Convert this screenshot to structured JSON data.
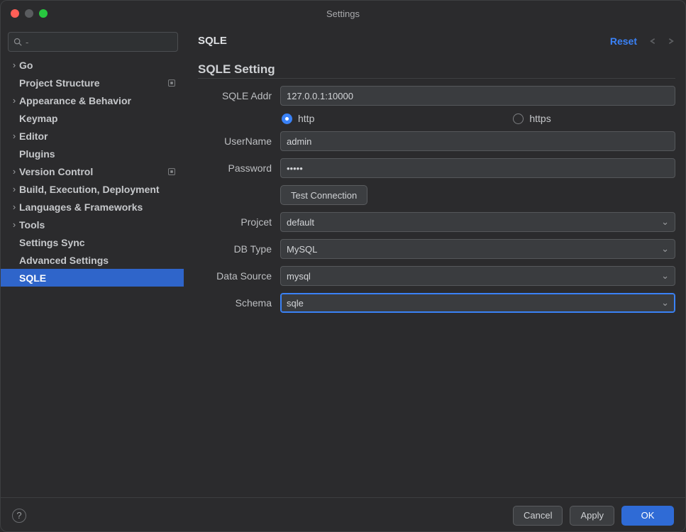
{
  "window": {
    "title": "Settings"
  },
  "search": {
    "placeholder": ""
  },
  "sidebar": {
    "items": [
      {
        "label": "Go",
        "expandable": true
      },
      {
        "label": "Project Structure",
        "expandable": false,
        "modified": true
      },
      {
        "label": "Appearance & Behavior",
        "expandable": true
      },
      {
        "label": "Keymap",
        "expandable": false
      },
      {
        "label": "Editor",
        "expandable": true
      },
      {
        "label": "Plugins",
        "expandable": false
      },
      {
        "label": "Version Control",
        "expandable": true,
        "modified": true
      },
      {
        "label": "Build, Execution, Deployment",
        "expandable": true
      },
      {
        "label": "Languages & Frameworks",
        "expandable": true
      },
      {
        "label": "Tools",
        "expandable": true
      },
      {
        "label": "Settings Sync",
        "expandable": false
      },
      {
        "label": "Advanced Settings",
        "expandable": false
      },
      {
        "label": "SQLE",
        "expandable": false,
        "selected": true
      }
    ]
  },
  "breadcrumb": "SQLE",
  "reset_label": "Reset",
  "section": "SQLE Setting",
  "form": {
    "addr_label": "SQLE Addr",
    "addr_value": "127.0.0.1:10000",
    "protocol_http": "http",
    "protocol_https": "https",
    "protocol_selected": "http",
    "username_label": "UserName",
    "username_value": "admin",
    "password_label": "Password",
    "password_value": "•••••",
    "test_connection": "Test Connection",
    "project_label": "Projcet",
    "project_value": "default",
    "dbtype_label": "DB Type",
    "dbtype_value": "MySQL",
    "datasource_label": "Data Source",
    "datasource_value": "mysql",
    "schema_label": "Schema",
    "schema_value": "sqle"
  },
  "footer": {
    "cancel": "Cancel",
    "apply": "Apply",
    "ok": "OK"
  }
}
